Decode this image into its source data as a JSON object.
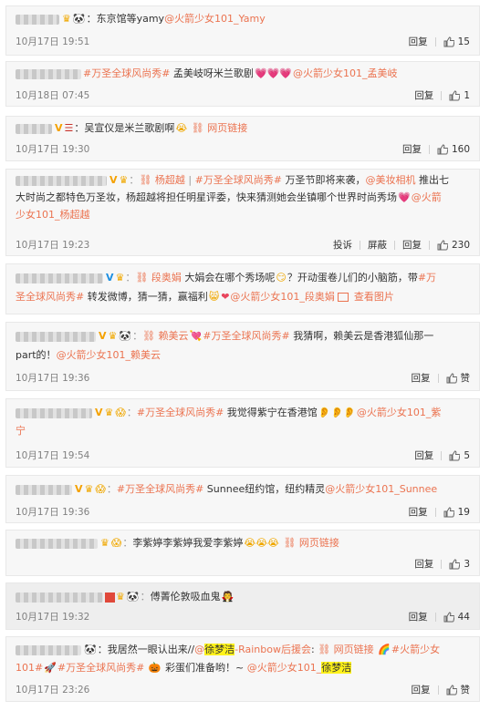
{
  "ops": {
    "reply": "回复",
    "report": "投诉",
    "block": "屏蔽",
    "like_placeholder": "赞",
    "web_link": "网页链接",
    "view_pic": "查看图片"
  },
  "comments": [
    {
      "text": "：东京馆等yamy",
      "mention": "@火箭少女101_Yamy",
      "date": "10月17日",
      "time": "19:51",
      "likes": "15"
    },
    {
      "topic": "#万圣全球风尚秀#",
      "text": " 孟美岐呀米兰歌剧",
      "mention": "@火箭少女101_孟美岐",
      "date": "10月18日",
      "time": "07:45",
      "likes": "1"
    },
    {
      "text": "：吴宣仪是米兰歌剧啊",
      "date": "10月17日",
      "time": "19:30",
      "likes": "160"
    },
    {
      "mention_a": "杨超越",
      "topic": "#万圣全球风尚秀#",
      "text_a": "万圣节即将来袭，",
      "mention_b": "@美妆相机",
      "text_b": "推出七",
      "text_c": "大时尚之都特色万圣妆，杨超越将担任明星评委，快来猜测她会坐镇哪个世界时尚秀场",
      "mention_c": "@火箭",
      "mention_d": "少女101_杨超越",
      "date": "10月17日",
      "time": "19:23",
      "likes": "230"
    },
    {
      "mention_a": "段奥娟",
      "text_a": "大娟会在哪个秀场呢",
      "text_b": "？开动蛋卷儿们的小脑筋，带",
      "topic_a": "#万",
      "topic_b": "圣全球风尚秀#",
      "text_c": "转发微博，猜一猜，赢福利",
      "mention": "@火箭少女101_段奥娟"
    },
    {
      "mention_a": "赖美云",
      "topic": "#万圣全球风尚秀#",
      "text_a": "我猜啊，赖美云是香港狐仙那一",
      "text_b": "part的！",
      "mention": "@火箭少女101_赖美云",
      "date": "10月17日",
      "time": "19:36"
    },
    {
      "topic": "#万圣全球风尚秀#",
      "text": "我觉得紫宁在香港馆",
      "mention_a": "@火箭少女101_紫",
      "mention_b": "宁",
      "date": "10月17日",
      "time": "19:54",
      "likes": "5"
    },
    {
      "topic": "#万圣全球风尚秀#",
      "text": "Sunnee纽约馆，纽约精灵",
      "mention": "@火箭少女101_Sunnee",
      "date": "10月17日",
      "time": "19:36",
      "likes": "19"
    },
    {
      "text": "李紫婷李紫婷我爱李紫婷",
      "likes": "3"
    },
    {
      "text": "傅菁伦敦吸血鬼",
      "date": "10月17日",
      "time": "19:32",
      "likes": "44"
    },
    {
      "text_a": "：我居然一眼认出来//",
      "mention_a": "@",
      "hl": "徐梦洁",
      "mention_b": "-Rainbow后援会",
      "text_b": ":",
      "mention_c": "#火箭少女",
      "topic": "101#",
      "topic_b": "#万圣全球风尚秀#",
      "text_c": "彩蛋们准备哟！~",
      "mention_d": "@火箭少女101_",
      "hl_b": "徐梦洁",
      "date": "10月17日",
      "time": "23:26"
    }
  ]
}
